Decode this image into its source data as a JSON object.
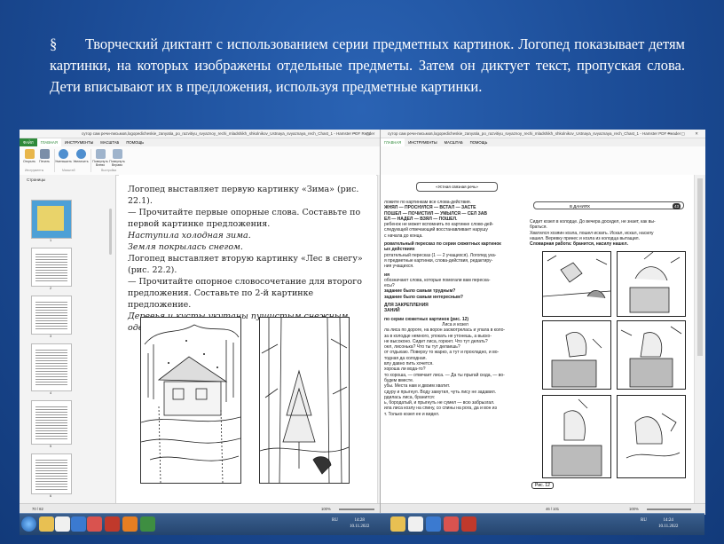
{
  "slide": {
    "bullet": "§",
    "text": "Творческий диктант с использованием серии предметных картинок. Логопед показывает детям картинки, на которых изображены отдельные предметы. Затем он диктует текст, пропуская слова. Дети вписывают их в предложения, используя предметные картинки."
  },
  "left_window": {
    "title": "сутор сам речи-письмов,logopedicheskie_zanyatia_po_razvitiyu_svyaznoy_rechi_mladshikh_shkolnikov_Ustnaya_svyaznaya_rech_Chast_1 - Hamster PDF Reader",
    "menu": {
      "file": "ФАЙЛ",
      "home": "ГЛАВНАЯ",
      "tools": "ИНСТРУМЕНТЫ",
      "scale": "МАСШТАБ",
      "help": "ПОМОЩЬ"
    },
    "ribbon": {
      "open": "Открыть",
      "print": "Печать",
      "zoom_out": "Уменьшить",
      "zoom_in": "Увеличить",
      "rotate_left": "Повернуть Влево",
      "rotate_right": "Повернуть Вправо",
      "group_tools": "Инструменты",
      "group_scale": "Масштаб",
      "group_view": "Выстройка"
    },
    "sidebar": {
      "header": "Страницы",
      "pages": [
        "1",
        "2",
        "3",
        "4",
        "5",
        "6"
      ]
    },
    "page": {
      "l1": "Логопед выставляет первую картинку «Зима» (рис. 22.1).",
      "l2": "— Прочитайте первые опорные слова. Составьте по первой картинке предложения.",
      "l3": "Наступила холодная зима.",
      "l4": "Земля покрылась снегом.",
      "l5": "Логопед выставляет вторую картинку «Лес в снегу» (рис. 22.2).",
      "l6": "— Прочитайте опорное словосочетание для второго предложения. Составьте по 2-й картинке предложение.",
      "l7": "Деревья и кусты укутаны пушистым снежным одеялом."
    },
    "status": {
      "page": "70 / 82",
      "zoom": "100%"
    }
  },
  "right_window": {
    "title": "сутор сам речи-письмов,logopedicheskie_zanyatia_po_razvitiyu_svyaznoy_rechi_mladshikh_shkolnikov_Ustnaya_svyaznaya_rech_Chast_1 - Hamster PDF Reader",
    "menu": {
      "home": "ГЛАВНАЯ",
      "tools": "ИНСТРУМЕНТЫ",
      "scale": "МАСШТАБ",
      "help": "ПОМОЩЬ"
    },
    "left_text": {
      "h1": "«Устная связная речь»",
      "a1": "ложите по картинкам все слова-действия.",
      "a2": "ЖНЯЛ — ПРОСНУЛСЯ — ВСТАЛ — ЗАСТЕ",
      "a3": "ПОШЕЛ — ПОЧИСТИЛ — УМЫЛСЯ — СЕЛ ЗАВ",
      "a4": "ЕЛ — НАДЕЛ — ВЗЯЛ — ПОШЕЛ.",
      "a5": "ребенок не может вспомнить по картинке слово-дей-",
      "a6": "следующей отвечающий восстанавливает нарушу",
      "a7": "с начала до конца.",
      "h2": "ровательный пересказ по серии сюжетных картинок",
      "h2b": "ых действиях",
      "b1": "ротательный пересказ (1 — 2 учащихся). Логопед ука-",
      "b2": "я предметные картинки, слова-действия, редактиру-",
      "b3": "ния учащихся.",
      "h3": "ия",
      "c1": "обозначают слова, которые помогали вам переска-",
      "c2": "есы?",
      "c3": "задание было самым трудным?",
      "c4": "задание было самым интересным?",
      "h4": "ДЛЯ ЗАКРЕПЛЕНИЯ",
      "h4b": "ЗАНИЙ",
      "h5": "по серии сюжетных картинок (рис. 12)",
      "story_title": "Лиса и козел",
      "s1": "ла лиса по дороге, на ворон засмотрелась и упала в коло-",
      "s2": "за в колодце немного, упокать не утонешь, а выско-",
      "s3": "не высоконо. Сидит лиса, горюет. Что тут делать?",
      "s4": "оел, лисонька? Что ты тут делаешь?",
      "s5": "от отдыхаю. Поверху то жарко, а тут и прохладно, и во-",
      "s6": "тодная да холодная.",
      "s7": "влу давно пить хочется.",
      "s8": "хороша ли вода-то?",
      "s9": "то хороша, — отвечает лиса. — Да ты прыгай сюда, — во-",
      "s10": "будем вместе.",
      "s11": "убы. Места нам и двоим хватит.",
      "s12": "сдуру и прыгнул. Воду замутил, чуть лису не задавил.",
      "s13": "рдилась лиса, бранится:",
      "s14": "ь, бородатый, и прыгнуть не сумел — всю забрызгал.",
      "s15": "ила лиса козлу на спину, со спины на рога, да и вон из",
      "s16": "т. Только козел ее и видел."
    },
    "right_text": {
      "heading": "В ДАНИЯХ",
      "page_num": "43",
      "r1": "Сидит козел в колодце. До вечера досидел, не знает, как вы-",
      "r2": "браться.",
      "r3": "Хватился хозяин козла, пошел искать. Искал, искал, насилу",
      "r4": "нашел. Веревку принес и козла из колодца вытащил.",
      "r5": "Словарная работа: бранится, насилу нашел.",
      "fig": "Рис. 12"
    },
    "status": {
      "page": "46 / 101",
      "zoom": "100%"
    }
  },
  "taskbar": {
    "lang": "RU",
    "time": "14:28",
    "date": "10.11.2022",
    "lang2": "RU",
    "time2": "14:24",
    "date2": "10.11.2022"
  }
}
